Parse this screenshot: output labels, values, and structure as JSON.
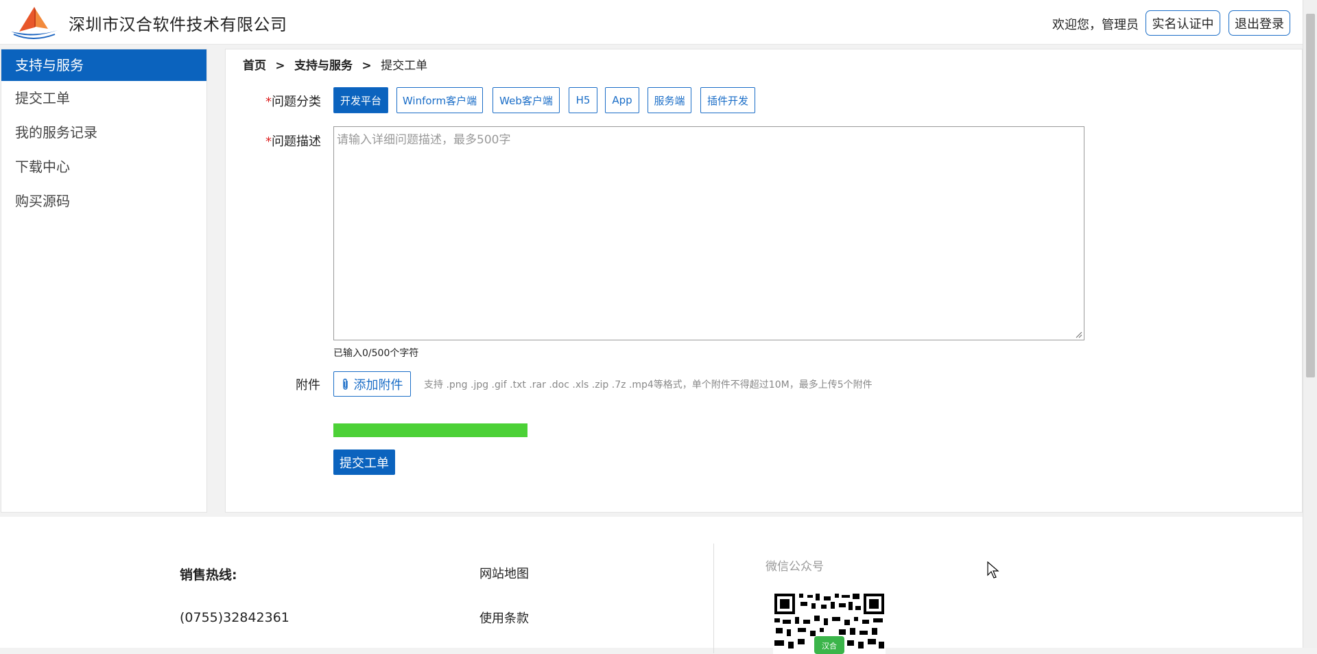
{
  "header": {
    "company_name": "深圳市汉合软件技术有限公司",
    "welcome_text": "欢迎您，管理员",
    "verify_button": "实名认证中",
    "logout_button": "退出登录"
  },
  "sidebar": {
    "items": [
      {
        "label": "支持与服务",
        "active": true
      },
      {
        "label": "提交工单"
      },
      {
        "label": "我的服务记录"
      },
      {
        "label": "下载中心"
      },
      {
        "label": "购买源码"
      }
    ]
  },
  "breadcrumb": {
    "home": "首页",
    "separator": ">",
    "section": "支持与服务",
    "current": "提交工单"
  },
  "form": {
    "required_mark": "*",
    "category_label": "问题分类",
    "categories": [
      {
        "label": "开发平台",
        "selected": true
      },
      {
        "label": "Winform客户端"
      },
      {
        "label": "Web客户端"
      },
      {
        "label": "H5"
      },
      {
        "label": "App"
      },
      {
        "label": "服务端"
      },
      {
        "label": "插件开发"
      }
    ],
    "description_label": "问题描述",
    "description_placeholder": "请输入详细问题描述，最多500字",
    "char_count": "已输入0/500个字符",
    "attachment_label": "附件",
    "attach_button": "添加附件",
    "attach_hint": "支持 .png .jpg .gif .txt .rar .doc .xls .zip .7z .mp4等格式，单个附件不得超过10M，最多上传5个附件",
    "progress": 1.0,
    "submit_button": "提交工单"
  },
  "footer": {
    "hotline_label": "销售热线:",
    "phone": "(0755)32842361",
    "links": [
      "网站地图",
      "使用条款"
    ],
    "wechat_label": "微信公众号",
    "qr_badge": "汉合"
  },
  "colors": {
    "primary": "#0b63be",
    "progress": "#4cd137",
    "required": "#dd2222"
  }
}
